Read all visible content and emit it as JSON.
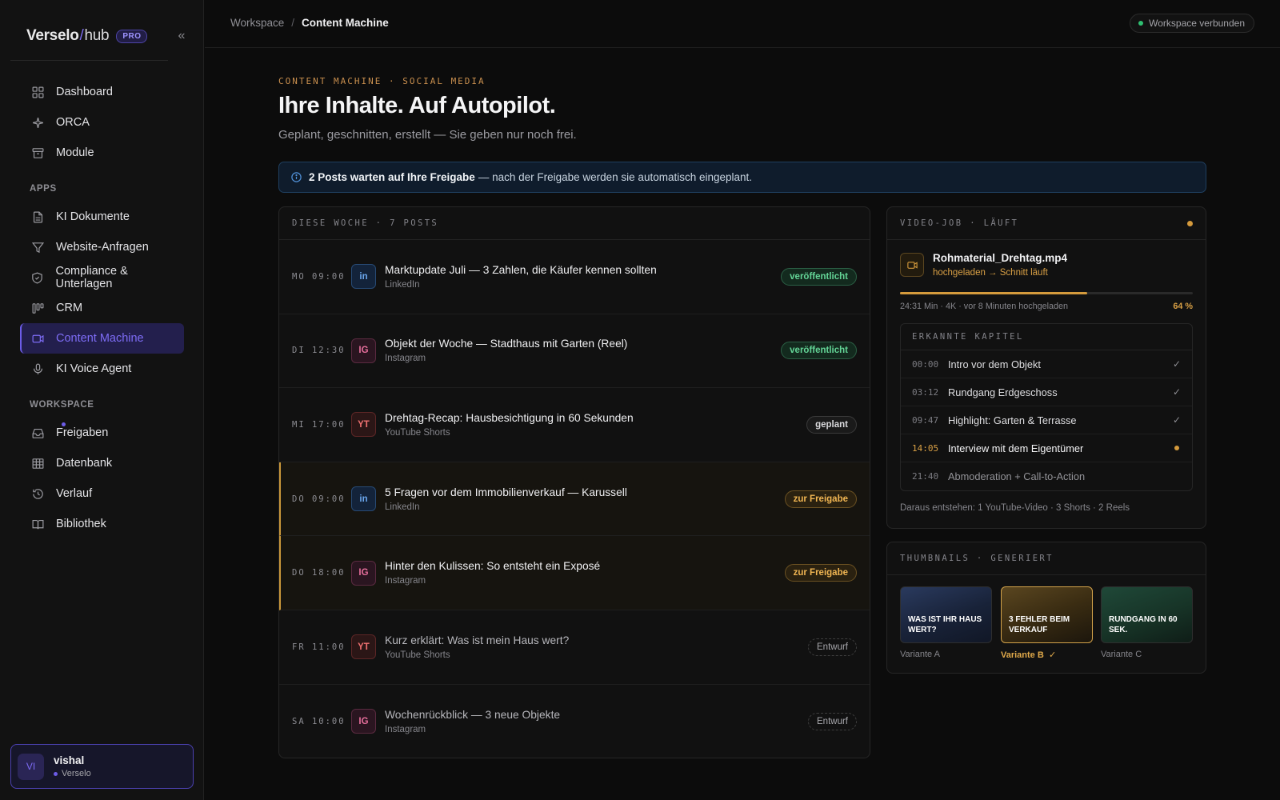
{
  "brand": {
    "name": "Verselo",
    "slash": "/",
    "suffix": "hub",
    "badge": "PRO",
    "collapse_icon": "«"
  },
  "nav": {
    "main": [
      {
        "label": "Dashboard",
        "icon": "grid-icon"
      },
      {
        "label": "ORCA",
        "icon": "sparkle-icon"
      },
      {
        "label": "Module",
        "icon": "archive-icon"
      }
    ],
    "apps_heading": "APPS",
    "apps": [
      {
        "label": "KI Dokumente",
        "icon": "document-icon"
      },
      {
        "label": "Website-Anfragen",
        "icon": "filter-icon"
      },
      {
        "label": "Compliance & Unterlagen",
        "icon": "shield-icon"
      },
      {
        "label": "CRM",
        "icon": "kanban-icon"
      },
      {
        "label": "Content Machine",
        "icon": "video-icon",
        "active": true
      },
      {
        "label": "KI Voice Agent",
        "icon": "microphone-icon"
      }
    ],
    "workspace_heading": "WORKSPACE",
    "workspace": [
      {
        "label": "Freigaben",
        "icon": "inbox-icon"
      },
      {
        "label": "Datenbank",
        "icon": "table-icon"
      },
      {
        "label": "Verlauf",
        "icon": "history-icon"
      },
      {
        "label": "Bibliothek",
        "icon": "book-icon"
      }
    ]
  },
  "user": {
    "initials": "VI",
    "name": "vishal",
    "org": "Verselo"
  },
  "breadcrumb": {
    "root": "Workspace",
    "separator": "/",
    "current": "Content Machine"
  },
  "workspace_status": "Workspace verbunden",
  "hero": {
    "eyebrow": "CONTENT MACHINE · SOCIAL MEDIA",
    "title": "Ihre Inhalte. Auf Autopilot.",
    "subtitle": "Geplant, geschnitten, erstellt — Sie geben nur noch frei."
  },
  "banner": {
    "strong": "2 Posts warten auf Ihre Freigabe",
    "rest": "— nach der Freigabe werden sie automatisch eingeplant."
  },
  "schedule": {
    "heading": "DIESE WOCHE · 7 POSTS",
    "posts": [
      {
        "time": "MO 09:00",
        "platform_badge": "in",
        "platform_class": "plat-in",
        "title": "Marktupdate Juli — 3 Zahlen, die Käufer kennen sollten",
        "platform": "LinkedIn",
        "status": "veröffentlicht",
        "status_class": "st-published",
        "row_class": ""
      },
      {
        "time": "DI 12:30",
        "platform_badge": "IG",
        "platform_class": "plat-ig",
        "title": "Objekt der Woche — Stadthaus mit Garten (Reel)",
        "platform": "Instagram",
        "status": "veröffentlicht",
        "status_class": "st-published",
        "row_class": ""
      },
      {
        "time": "MI 17:00",
        "platform_badge": "YT",
        "platform_class": "plat-yt",
        "title": "Drehtag-Recap: Hausbesichtigung in 60 Sekunden",
        "platform": "YouTube Shorts",
        "status": "geplant",
        "status_class": "st-planned",
        "row_class": ""
      },
      {
        "time": "DO 09:00",
        "platform_badge": "in",
        "platform_class": "plat-in",
        "title": "5 Fragen vor dem Immobilienverkauf — Karussell",
        "platform": "LinkedIn",
        "status": "zur Freigabe",
        "status_class": "st-approve",
        "row_class": "pending"
      },
      {
        "time": "DO 18:00",
        "platform_badge": "IG",
        "platform_class": "plat-ig",
        "title": "Hinter den Kulissen: So entsteht ein Exposé",
        "platform": "Instagram",
        "status": "zur Freigabe",
        "status_class": "st-approve",
        "row_class": "pending"
      },
      {
        "time": "FR 11:00",
        "platform_badge": "YT",
        "platform_class": "plat-yt",
        "title": "Kurz erklärt: Was ist mein Haus wert?",
        "platform": "YouTube Shorts",
        "status": "Entwurf",
        "status_class": "st-draft",
        "row_class": "draft"
      },
      {
        "time": "SA 10:00",
        "platform_badge": "IG",
        "platform_class": "plat-ig",
        "title": "Wochenrückblick — 3 neue Objekte",
        "platform": "Instagram",
        "status": "Entwurf",
        "status_class": "st-draft",
        "row_class": "draft"
      }
    ]
  },
  "video_job": {
    "heading": "VIDEO-JOB · LÄUFT",
    "file_name": "Rohmaterial_Drehtag.mp4",
    "state": "hochgeladen → Schnitt läuft",
    "progress_percent": 64,
    "meta": "24:31 Min · 4K · vor 8 Minuten hochgeladen",
    "progress_label": "64 %",
    "chapters_heading": "ERKANNTE KAPITEL",
    "chapters": [
      {
        "time": "00:00",
        "title": "Intro vor dem Objekt",
        "state": "done"
      },
      {
        "time": "03:12",
        "title": "Rundgang Erdgeschoss",
        "state": "done"
      },
      {
        "time": "09:47",
        "title": "Highlight: Garten & Terrasse",
        "state": "done"
      },
      {
        "time": "14:05",
        "title": "Interview mit dem Eigentümer",
        "state": "current"
      },
      {
        "time": "21:40",
        "title": "Abmoderation + Call-to-Action",
        "state": "pending"
      }
    ],
    "check_mark": "✓",
    "footer": "Daraus entstehen: 1 YouTube-Video · 3 Shorts · 2 Reels"
  },
  "thumbnails": {
    "heading": "THUMBNAILS · GENERIERT",
    "items": [
      {
        "text": "WAS IST IHR HAUS WERT?",
        "label": "Variante A",
        "selected": false
      },
      {
        "text": "3 FEHLER BEIM VERKAUF",
        "label": "Variante B",
        "selected": true
      },
      {
        "text": "RUNDGANG IN 60 SEK.",
        "label": "Variante C",
        "selected": false
      }
    ],
    "selected_mark": "✓"
  },
  "colors": {
    "accent": "#6c5ce7",
    "warning": "#d49a3c",
    "success": "#63d496",
    "background": "#0c0c0c"
  }
}
